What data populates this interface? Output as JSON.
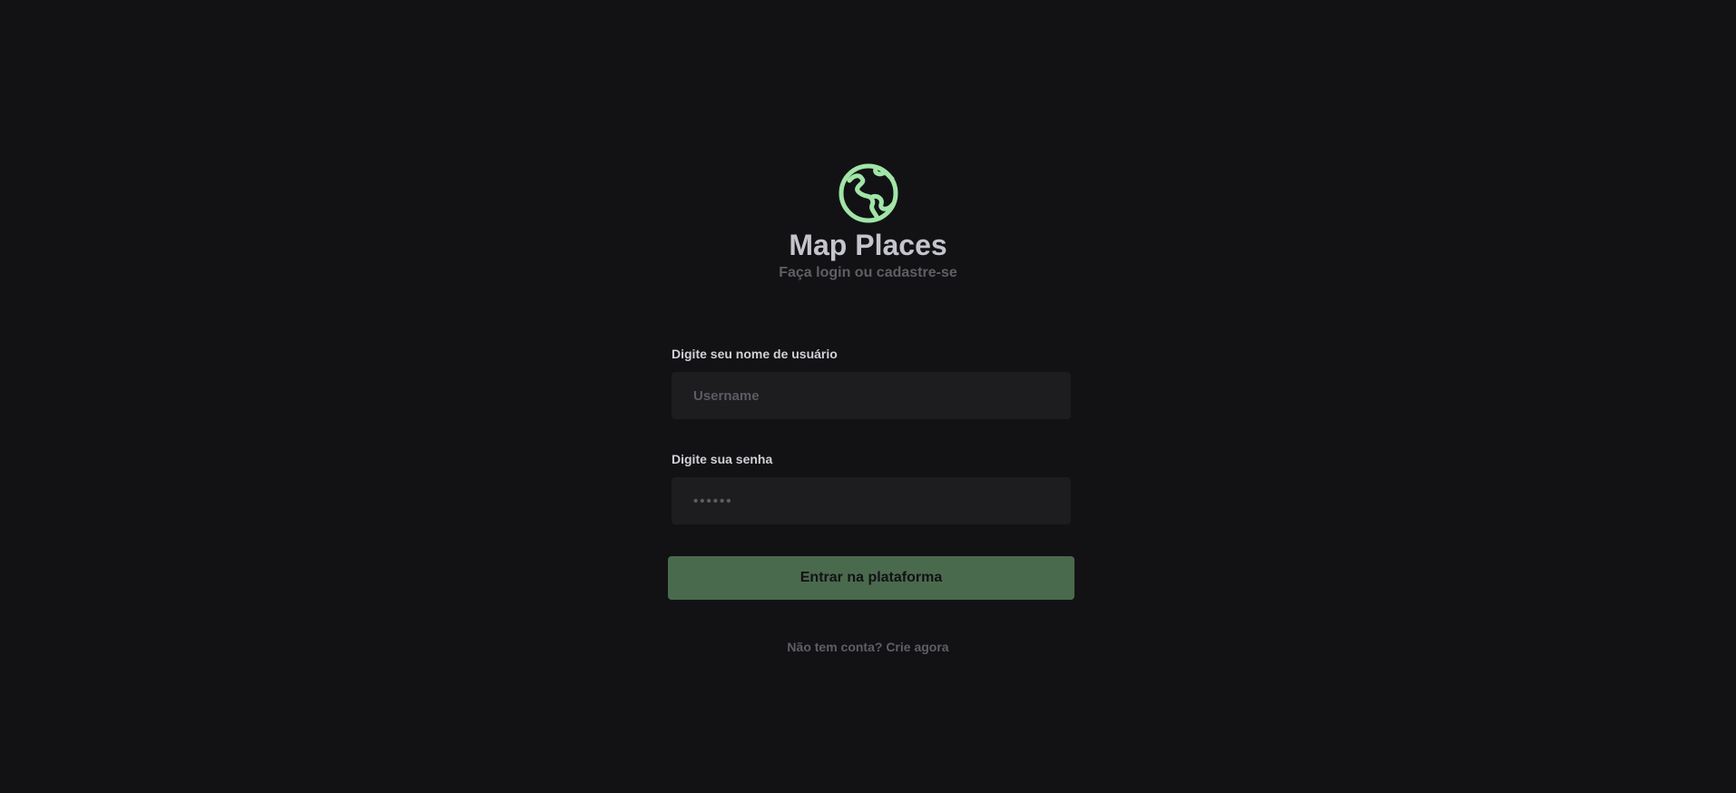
{
  "brand": {
    "logo_icon": "globe-icon",
    "accent_color": "#a1e5a8",
    "title": "Map Places",
    "subtitle": "Faça login ou cadastre-se"
  },
  "form": {
    "username": {
      "label": "Digite seu nome de usuário",
      "placeholder": "Username",
      "value": ""
    },
    "password": {
      "label": "Digite sua senha",
      "placeholder": "••••••",
      "value": ""
    },
    "submit_label": "Entrar na plataforma",
    "submit_color": "#4a6a4d"
  },
  "signup_link": "Não tem conta? Crie agora"
}
